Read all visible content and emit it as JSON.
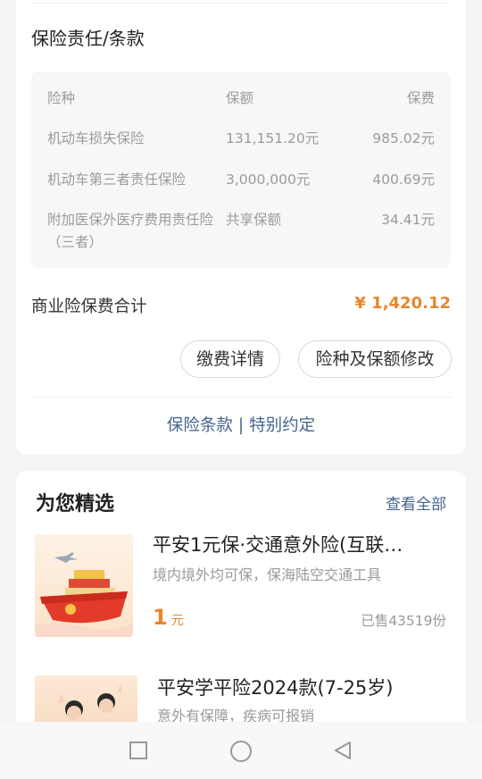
{
  "coverage": {
    "title": "保险责任/条款",
    "headers": [
      "险种",
      "保额",
      "保费"
    ],
    "rows": [
      {
        "name": "机动车损失保险",
        "amount": "131,151.20元",
        "premium": "985.02元"
      },
      {
        "name": "机动车第三者责任保险",
        "amount": "3,000,000元",
        "premium": "400.69元"
      },
      {
        "name": "附加医保外医疗费用责任险（三者）",
        "amount": "共享保额",
        "premium": "34.41元"
      }
    ],
    "total_label": "商业险保费合计",
    "total_value": "¥ 1,420.12",
    "buttons": {
      "payment_details": "缴费详情",
      "modify_coverage": "险种及保额修改"
    },
    "links": {
      "terms": "保险条款",
      "separator": "|",
      "special": "特别约定"
    }
  },
  "recommend": {
    "title": "为您精选",
    "view_all": "查看全部",
    "products": [
      {
        "title": "平安1元保·交通意外险(互联…",
        "subtitle": "境内境外均可保，保海陆空交通工具",
        "price": "1",
        "unit": "元",
        "sold": "已售43519份"
      },
      {
        "title": "平安学平险2024款(7-25岁)",
        "subtitle": "意外有保障，疾病可报销"
      }
    ]
  },
  "colors": {
    "accent": "#e8862a",
    "link": "#46648a"
  },
  "navbar": {
    "icons": [
      "square-icon",
      "circle-icon",
      "back-triangle-icon"
    ]
  }
}
